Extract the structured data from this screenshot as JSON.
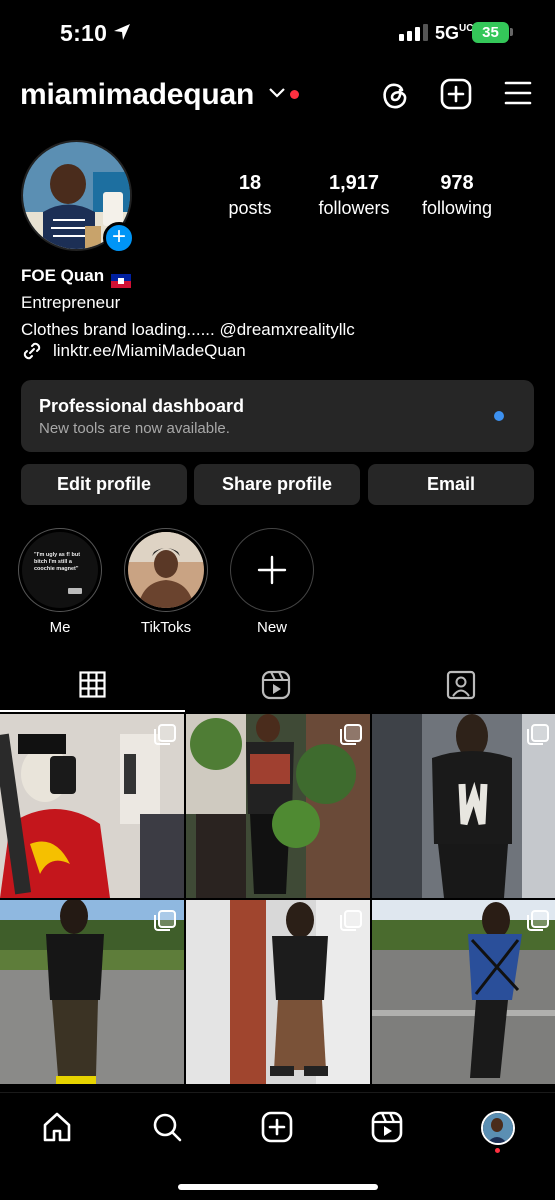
{
  "status_bar": {
    "time": "5:10",
    "network": "5G",
    "network_sup": "UC",
    "battery": "35"
  },
  "header": {
    "username": "miamimadequan",
    "icons": [
      "threads-icon",
      "create-icon",
      "menu-icon"
    ]
  },
  "profile": {
    "stats": [
      {
        "num": "18",
        "label": "posts"
      },
      {
        "num": "1,917",
        "label": "followers"
      },
      {
        "num": "978",
        "label": "following"
      }
    ],
    "name": "FOE Quan",
    "category": "Entrepreneur",
    "bio": "Clothes brand loading...... @dreamxrealityllc",
    "link": "linktr.ee/MiamiMadeQuan"
  },
  "dashboard": {
    "title": "Professional dashboard",
    "subtitle": "New tools are now available."
  },
  "buttons": {
    "edit": "Edit profile",
    "share": "Share profile",
    "email": "Email"
  },
  "highlights": [
    {
      "label": "Me",
      "quote": "\"I'm ugly as f! but bitch I'm still a coochie magnet\""
    },
    {
      "label": "TikToks"
    },
    {
      "label": "New"
    }
  ],
  "tabs": [
    "grid-icon",
    "reels-icon",
    "tagged-icon"
  ],
  "colors": {
    "accent": "#0095f6",
    "notification": "#ff3040",
    "battery": "#34c759",
    "surface": "#262626"
  }
}
